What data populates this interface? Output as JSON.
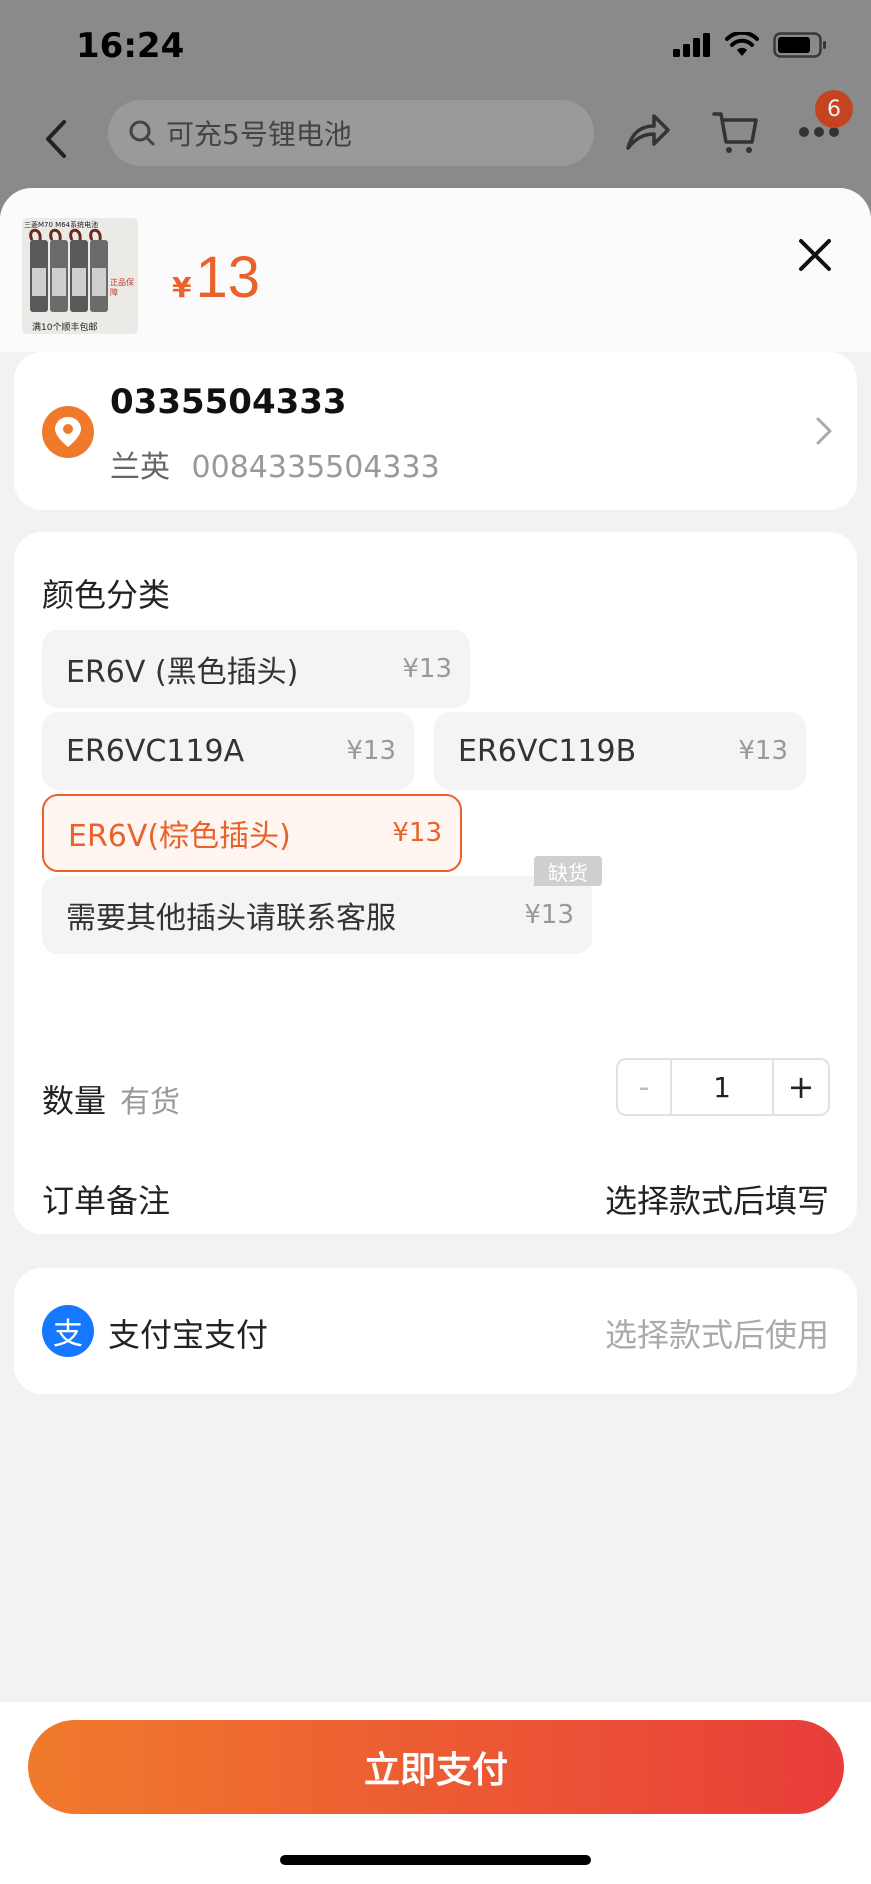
{
  "status_bar": {
    "time": "16:24"
  },
  "nav": {
    "search_placeholder": "可充5号锂电池",
    "badge_count": "6"
  },
  "product": {
    "price_symbol": "¥",
    "price": "13",
    "thumb_top_text": "三菱M70 M64系统电池",
    "thumb_stamp": "正品保障",
    "thumb_bottom_text": "满10个顺丰包邮"
  },
  "address": {
    "phone": "0335504333",
    "name": "兰英",
    "detail": "0084335504333"
  },
  "spec": {
    "title": "颜色分类",
    "options": [
      {
        "label": "ER6V (黑色插头)",
        "price": "¥13",
        "selected": false,
        "out_of_stock": false
      },
      {
        "label": "ER6VC119A",
        "price": "¥13",
        "selected": false,
        "out_of_stock": false
      },
      {
        "label": "ER6VC119B",
        "price": "¥13",
        "selected": false,
        "out_of_stock": false
      },
      {
        "label": "ER6V(棕色插头)",
        "price": "¥13",
        "selected": true,
        "out_of_stock": false
      },
      {
        "label": "需要其他插头请联系客服",
        "price": "¥13",
        "selected": false,
        "out_of_stock": true
      }
    ],
    "out_of_stock_label": "缺货"
  },
  "quantity": {
    "label": "数量",
    "stock_status": "有货",
    "minus": "-",
    "value": "1",
    "plus": "+"
  },
  "order_note": {
    "label": "订单备注",
    "value": "选择款式后填写"
  },
  "payment": {
    "icon_glyph": "支",
    "label": "支付宝支付",
    "hint": "选择款式后使用"
  },
  "footer": {
    "pay_button": "立即支付"
  },
  "colors": {
    "accent": "#e8622a",
    "alipay": "#1677ff"
  }
}
